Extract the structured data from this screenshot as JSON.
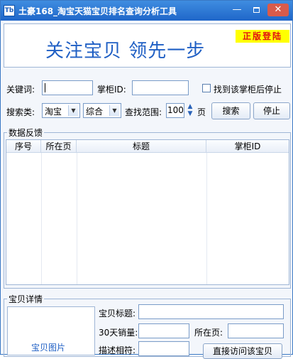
{
  "window": {
    "title": "土豪168_淘宝天猫宝贝排名查询分析工具",
    "icon_text": "Tb",
    "minimize": "—",
    "close": "✕"
  },
  "banner": {
    "slogan": "关注宝贝  领先一步",
    "badge": "正版登陆"
  },
  "search": {
    "keyword_label": "关键词:",
    "keyword_value": "",
    "shop_id_label": "掌柜ID:",
    "shop_id_value": "",
    "stop_when_found_label": "找到该掌柜后停止",
    "stop_when_found_checked": false,
    "search_type_label": "搜索类:",
    "platform_value": "淘宝",
    "sort_value": "综合",
    "range_label": "查找范围:",
    "range_value": "100",
    "pages_label": "页",
    "search_button": "搜索",
    "stop_button": "停止"
  },
  "results": {
    "group_title": "数据反馈",
    "columns": [
      "序号",
      "所在页",
      "标题",
      "掌柜ID"
    ],
    "rows": []
  },
  "details": {
    "group_title": "宝贝详情",
    "image_label": "宝贝图片",
    "title_label": "宝贝标题:",
    "title_value": "",
    "sales_label": "30天销量:",
    "sales_value": "",
    "page_label": "所在页:",
    "page_value": "",
    "match_label": "描述相符:",
    "match_value": "",
    "visit_button": "直接访问该宝贝"
  },
  "colors": {
    "titlebar": "#2a74d6",
    "slogan": "#1f5fc4",
    "badge_bg": "#ffff00",
    "badge_text": "#e01010"
  }
}
